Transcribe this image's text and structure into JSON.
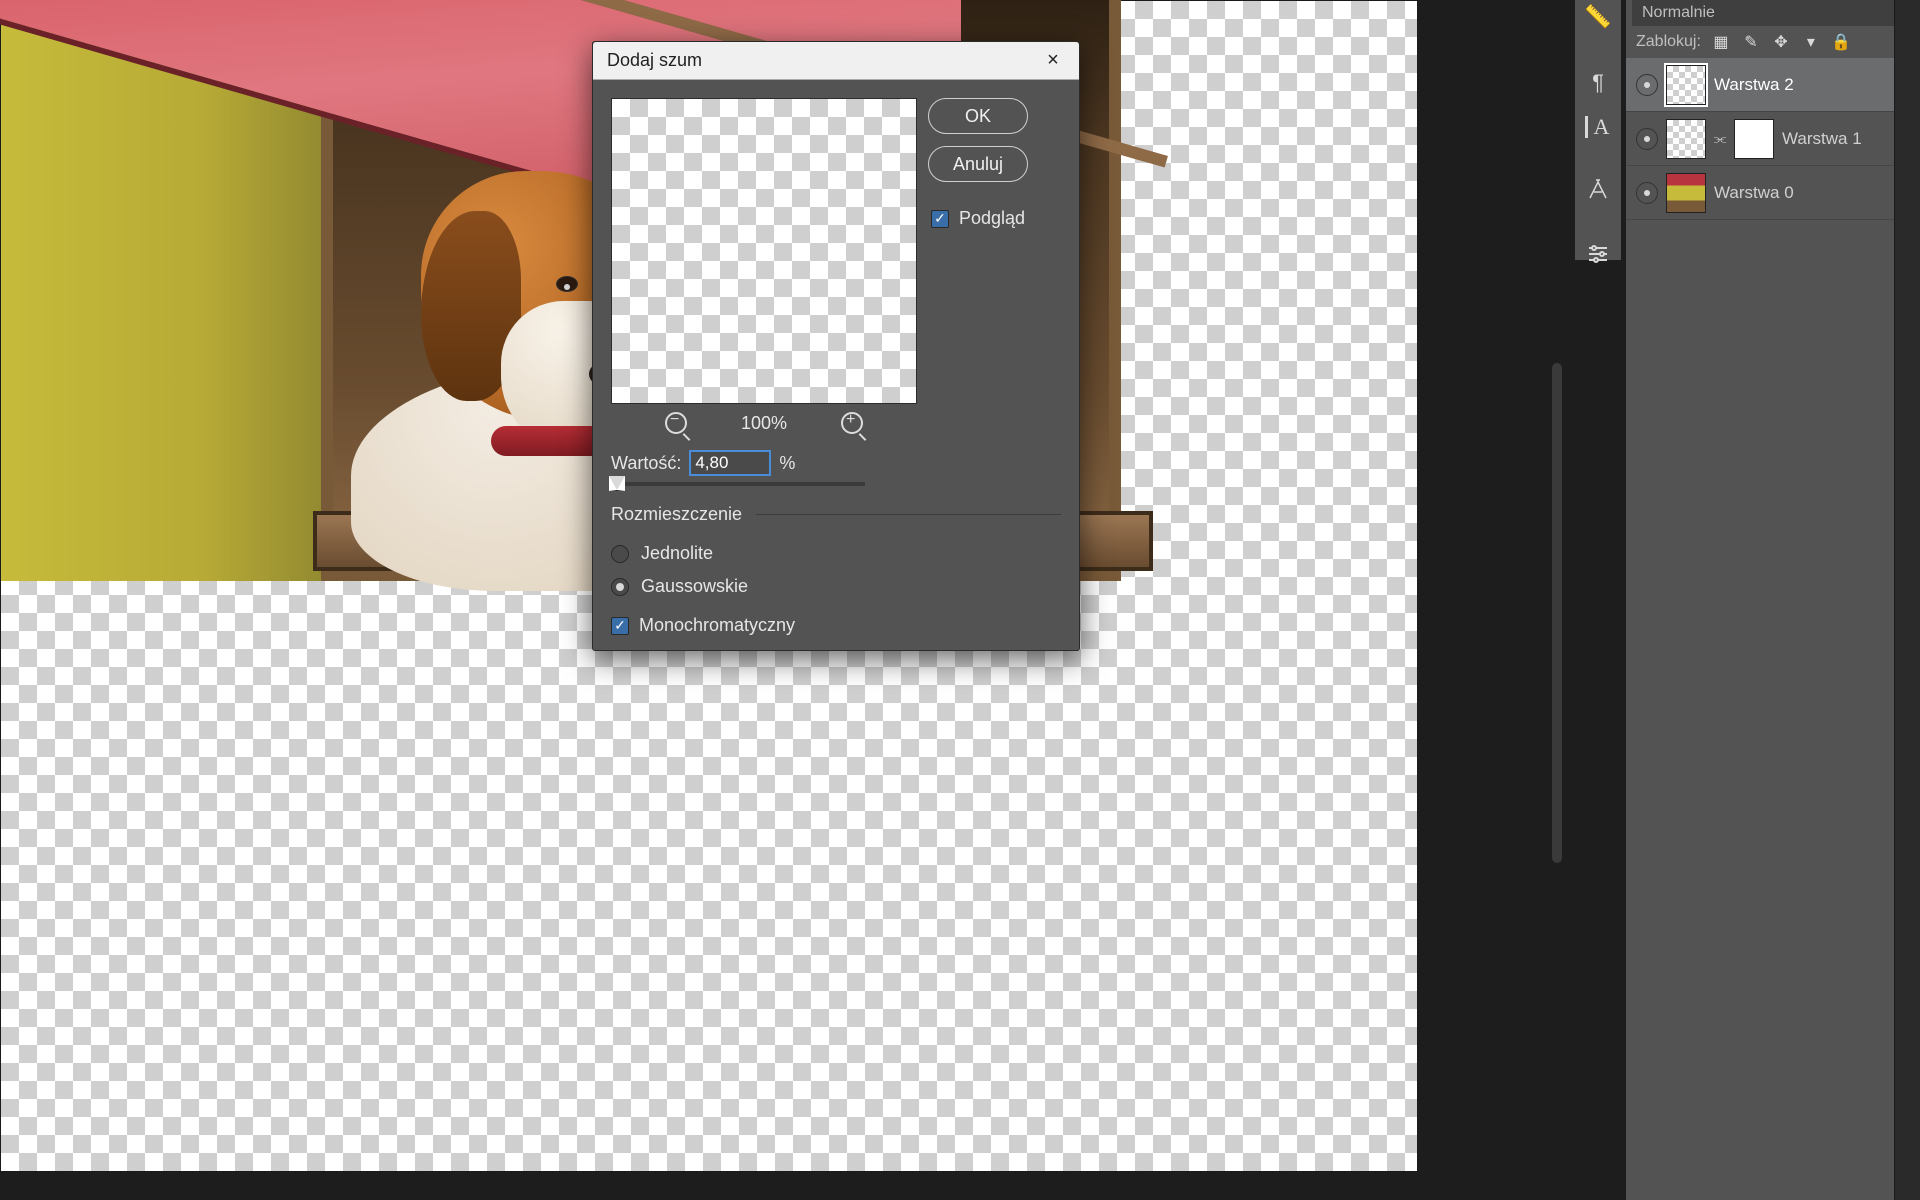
{
  "dialog": {
    "title": "Dodaj szum",
    "ok": "OK",
    "cancel": "Anuluj",
    "preview_label": "Podgląd",
    "zoom_label": "100%",
    "amount_label": "Wartość:",
    "amount_value": "4,80",
    "amount_unit": "%",
    "distribution_legend": "Rozmieszczenie",
    "uniform_label": "Jednolite",
    "gaussian_label": "Gaussowskie",
    "monochrome_label": "Monochromatyczny"
  },
  "blend_mode": "Normalnie",
  "lock_label": "Zablokuj:",
  "layers": [
    {
      "name": "Warstwa 2",
      "selected": true,
      "visible": true,
      "thumb": "checker",
      "mask": false
    },
    {
      "name": "Warstwa 1",
      "selected": false,
      "visible": true,
      "thumb": "checker",
      "mask": true
    },
    {
      "name": "Warstwa 0",
      "selected": false,
      "visible": true,
      "thumb": "img",
      "mask": false
    }
  ],
  "icons": {
    "close": "×",
    "zoom_out": "−",
    "zoom_in": "+",
    "para": "¶",
    "typeA": "A",
    "pen": "✒",
    "adjust": "☰",
    "lock_trans": "▦",
    "lock_paint": "✎",
    "lock_move": "✥",
    "lock_art": "▾",
    "lock_all": "🔒",
    "link": "⫘",
    "ruler": "📏"
  }
}
